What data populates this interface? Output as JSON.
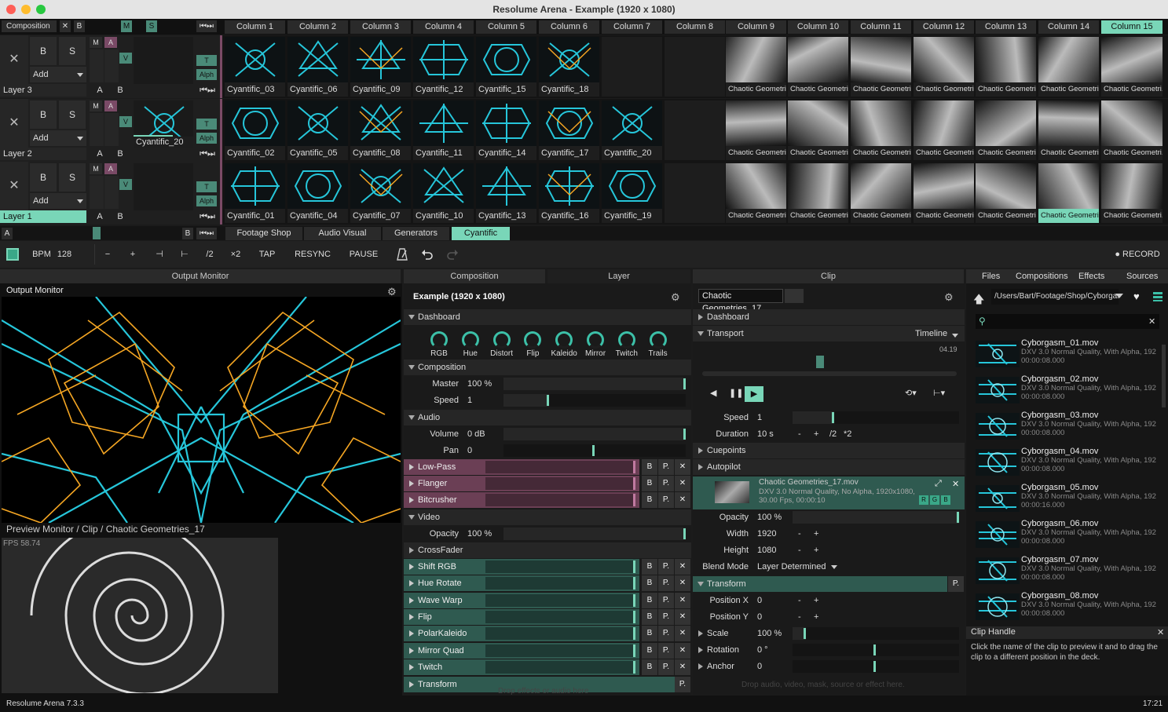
{
  "window": {
    "title": "Resolume Arena - Example (1920 x 1080)"
  },
  "composition_bar": {
    "label": "Composition",
    "x": "✕",
    "b": "B",
    "m": "M",
    "s": "S",
    "skip": "⏮⏭"
  },
  "columns": [
    "Column 1",
    "Column 2",
    "Column 3",
    "Column 4",
    "Column 5",
    "Column 6",
    "Column 7",
    "Column 8",
    "Column 9",
    "Column 10",
    "Column 11",
    "Column 12",
    "Column 13",
    "Column 14",
    "Column 15"
  ],
  "layer_controls": {
    "close": "✕",
    "b": "B",
    "s": "S",
    "add": "Add",
    "m": "M",
    "a": "A",
    "v": "V",
    "t": "T",
    "alph": "Alph",
    "ab_a": "A",
    "ab_b": "B",
    "skip": "⏮⏭"
  },
  "layers": [
    {
      "name": "Layer 3",
      "active_clip": "",
      "clips": [
        "Cyantific_03",
        "Cyantific_06",
        "Cyantific_09",
        "Cyantific_12",
        "Cyantific_15",
        "Cyantific_18",
        "",
        "",
        "Chaotic Geometri...",
        "Chaotic Geometri...",
        "Chaotic Geometri...",
        "Chaotic Geometri...",
        "Chaotic Geometri...",
        "Chaotic Geometri...",
        "Chaotic Geometri..."
      ]
    },
    {
      "name": "Layer 2",
      "active_clip": "Cyantific_20",
      "clips": [
        "Cyantific_02",
        "Cyantific_05",
        "Cyantific_08",
        "Cyantific_11",
        "Cyantific_14",
        "Cyantific_17",
        "Cyantific_20",
        "",
        "Chaotic Geometri...",
        "Chaotic Geometri...",
        "Chaotic Geometri...",
        "Chaotic Geometri...",
        "Chaotic Geometri...",
        "Chaotic Geometri...",
        "Chaotic Geometri..."
      ]
    },
    {
      "name": "Layer 1",
      "active_clip": "",
      "clips": [
        "Cyantific_01",
        "Cyantific_04",
        "Cyantific_07",
        "Cyantific_10",
        "Cyantific_13",
        "Cyantific_16",
        "Cyantific_19",
        "",
        "Chaotic Geometri...",
        "Chaotic Geometri...",
        "Chaotic Geometri...",
        "Chaotic Geometri...",
        "Chaotic Geometri...",
        "Chaotic Geometri...",
        "Chaotic Geometri..."
      ]
    }
  ],
  "deck_row": {
    "a": "A",
    "b": "B",
    "skip": "⏮⏭",
    "tabs": [
      "Footage Shop",
      "Audio Visual",
      "Generators",
      "Cyantific"
    ]
  },
  "toolbar": {
    "bpm_label": "BPM",
    "bpm": "128",
    "minus": "−",
    "plus": "+",
    "nudge_left": "⊣",
    "nudge_right": "⊢",
    "half": "/2",
    "double": "×2",
    "tap": "TAP",
    "resync": "RESYNC",
    "pause": "PAUSE",
    "record": "● RECORD"
  },
  "output": {
    "header": "Output Monitor",
    "title": "Output Monitor",
    "preview_title": "Preview Monitor / Clip / Chaotic Geometries_17",
    "fps": "FPS 58.74"
  },
  "comp_panel": {
    "tab_composition": "Composition",
    "tab_layer": "Layer",
    "name": "Example (1920 x 1080)",
    "dashboard": "Dashboard",
    "knobs": [
      "RGB",
      "Hue",
      "Distort",
      "Flip",
      "Kaleido",
      "Mirror",
      "Twitch",
      "Trails"
    ],
    "composition": "Composition",
    "master_label": "Master",
    "master": "100 %",
    "speed_label": "Speed",
    "speed": "1",
    "audio": "Audio",
    "volume_label": "Volume",
    "volume": "0 dB",
    "pan_label": "Pan",
    "pan": "0",
    "audio_fx": [
      "Low-Pass",
      "Flanger",
      "Bitcrusher"
    ],
    "video": "Video",
    "opacity_label": "Opacity",
    "opacity": "100 %",
    "crossfader": "CrossFader",
    "video_fx": [
      "Shift RGB",
      "Hue Rotate",
      "Wave Warp",
      "Flip",
      "PolarKaleido",
      "Mirror Quad",
      "Twitch"
    ],
    "transform": "Transform",
    "fx_b": "B",
    "fx_p": "P.",
    "fx_x": "✕",
    "drop_hint": "Drop effects or audio here"
  },
  "clip_panel": {
    "header": "Clip",
    "name": "Chaotic Geometries_17",
    "dashboard": "Dashboard",
    "transport": "Transport",
    "timeline": "Timeline",
    "time": "04.19",
    "speed_label": "Speed",
    "speed": "1",
    "duration_label": "Duration",
    "duration": "10 s",
    "dminus": "-",
    "dplus": "+",
    "dhalf": "/2",
    "ddouble": "*2",
    "cuepoints": "Cuepoints",
    "autopilot": "Autopilot",
    "file_name": "Chaotic Geometries_17.mov",
    "file_desc": "DXV 3.0 Normal Quality, No Alpha, 1920x1080,",
    "file_desc2": "30.00 Fps, 00:00:10",
    "r": "R",
    "g": "G",
    "b": "B",
    "opacity_label": "Opacity",
    "opacity": "100 %",
    "width_label": "Width",
    "width": "1920",
    "height_label": "Height",
    "height": "1080",
    "blend_label": "Blend Mode",
    "blend": "Layer Determined",
    "transform": "Transform",
    "p": "P.",
    "posx_label": "Position X",
    "posx": "0",
    "posy_label": "Position Y",
    "posy": "0",
    "scale_label": "Scale",
    "scale": "100 %",
    "rotation_label": "Rotation",
    "rotation": "0 °",
    "anchor_label": "Anchor",
    "anchor": "0",
    "drop_hint": "Drop audio, video, mask, source or effect here."
  },
  "browser": {
    "tabs": [
      "Files",
      "Compositions",
      "Effects",
      "Sources"
    ],
    "path": "/Users/Bart/Footage/Shop/Cyborgasm",
    "search_placeholder": "",
    "files": [
      {
        "name": "Cyborgasm_01.mov",
        "desc": "DXV 3.0 Normal Quality, With Alpha, 192",
        "dur": "00:00:08.000"
      },
      {
        "name": "Cyborgasm_02.mov",
        "desc": "DXV 3.0 Normal Quality, With Alpha, 192",
        "dur": "00:00:08.000"
      },
      {
        "name": "Cyborgasm_03.mov",
        "desc": "DXV 3.0 Normal Quality, With Alpha, 192",
        "dur": "00:00:08.000"
      },
      {
        "name": "Cyborgasm_04.mov",
        "desc": "DXV 3.0 Normal Quality, With Alpha, 192",
        "dur": "00:00:08.000"
      },
      {
        "name": "Cyborgasm_05.mov",
        "desc": "DXV 3.0 Normal Quality, With Alpha, 192",
        "dur": "00:00:16.000"
      },
      {
        "name": "Cyborgasm_06.mov",
        "desc": "DXV 3.0 Normal Quality, With Alpha, 192",
        "dur": "00:00:08.000"
      },
      {
        "name": "Cyborgasm_07.mov",
        "desc": "DXV 3.0 Normal Quality, With Alpha, 192",
        "dur": "00:00:08.000"
      },
      {
        "name": "Cyborgasm_08.mov",
        "desc": "DXV 3.0 Normal Quality, With Alpha, 192",
        "dur": "00:00:08.000"
      }
    ],
    "help_title": "Clip Handle",
    "help_text": "Click the name of the clip to preview it and to drag the clip to a different position in the deck."
  },
  "status": {
    "version": "Resolume Arena 7.3.3",
    "time": "17:21"
  },
  "colors": {
    "accent": "#79d6b8",
    "cyan": "#26c6da",
    "orange": "#f5a623",
    "audio_fx": "#6b3f55",
    "video_fx": "#2f5a50"
  }
}
